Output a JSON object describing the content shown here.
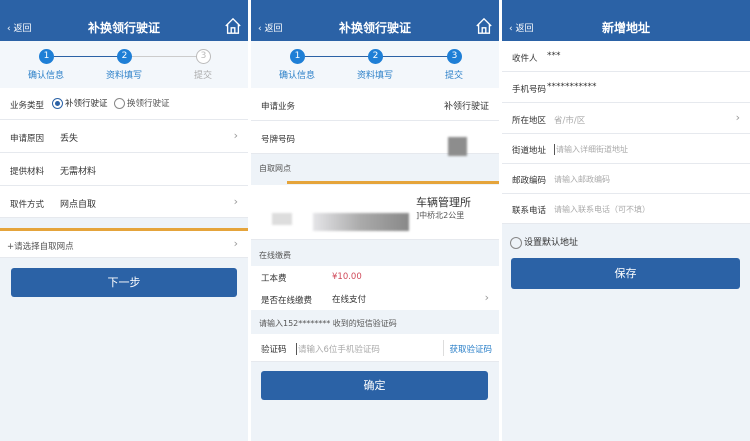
{
  "common": {
    "back": "返回"
  },
  "p1": {
    "title": "补换领行驶证",
    "steps": [
      "确认信息",
      "资料填写",
      "提交"
    ],
    "step_nums": [
      "1",
      "2",
      "3"
    ],
    "biz_type_label": "业务类型",
    "biz_opt1": "补领行驶证",
    "biz_opt2": "换领行驶证",
    "reason_label": "申请原因",
    "reason": "丢失",
    "material_label": "提供材料",
    "material": "无需材料",
    "pickup_label": "取件方式",
    "pickup": "网点自取",
    "select_point": "+请选择自取网点",
    "next": "下一步"
  },
  "p2": {
    "title": "补换领行驶证",
    "biz_label": "申请业务",
    "biz": "补领行驶证",
    "plate_label": "号牌号码",
    "point_section": "自取网点",
    "point_name": "车辆管理所",
    "point_dist": "]中桥北2公里",
    "pay_section": "在线缴费",
    "fee_label": "工本费",
    "fee": "¥10.00",
    "online_label": "是否在线缴费",
    "online": "在线支付",
    "sms_note": "请输入152******** 收到的短信验证码",
    "code_label": "验证码",
    "code_ph": "请输入6位手机验证码",
    "get_code": "获取验证码",
    "confirm": "确定"
  },
  "p3": {
    "title": "新增地址",
    "recv_label": "收件人",
    "recv": "***",
    "phone_label": "手机号码",
    "phone": "***********",
    "region_label": "所在地区",
    "region_ph": "省/市/区",
    "street_label": "街道地址",
    "street_ph": "请输入详细街道地址",
    "zip_label": "邮政编码",
    "zip_ph": "请输入邮政编码",
    "tel_label": "联系电话",
    "tel_ph": "请输入联系电话（可不填）",
    "default": "设置默认地址",
    "save": "保存"
  },
  "colors": {
    "primary": "#2b62a6",
    "step": "#1f7fd6",
    "accent": "#e5a43b",
    "price": "#d04a5a"
  }
}
